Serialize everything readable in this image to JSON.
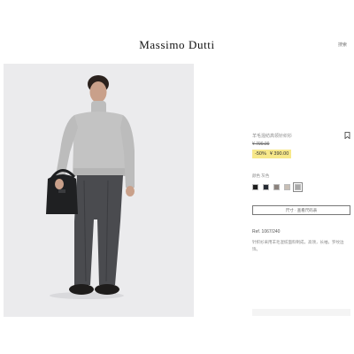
{
  "header": {
    "brand": "Massimo Dutti",
    "search_label": "搜索"
  },
  "product": {
    "name": "羊毛混纺高领针织衫",
    "old_price": "¥ 790.00",
    "discount": "-50%",
    "price": "¥ 390.00",
    "color_label": "颜色 灰色",
    "swatches": [
      {
        "name": "black",
        "color": "#1e1e1e"
      },
      {
        "name": "navy",
        "color": "#262a33"
      },
      {
        "name": "taupe",
        "color": "#8b827d"
      },
      {
        "name": "beige",
        "color": "#c8bfb5"
      },
      {
        "name": "grey",
        "color": "#a9a9a9"
      }
    ],
    "selected_color": "grey",
    "size_button": "尺寸 · 查看尺码表",
    "ref": "Ref. 1067/240",
    "description": "针织衫采用羊毛混纺面料制成，高领，长袖，罗纹边饰。"
  },
  "colors": {
    "sale_highlight": "#f7e88a",
    "photo_background": "#ebebed"
  }
}
